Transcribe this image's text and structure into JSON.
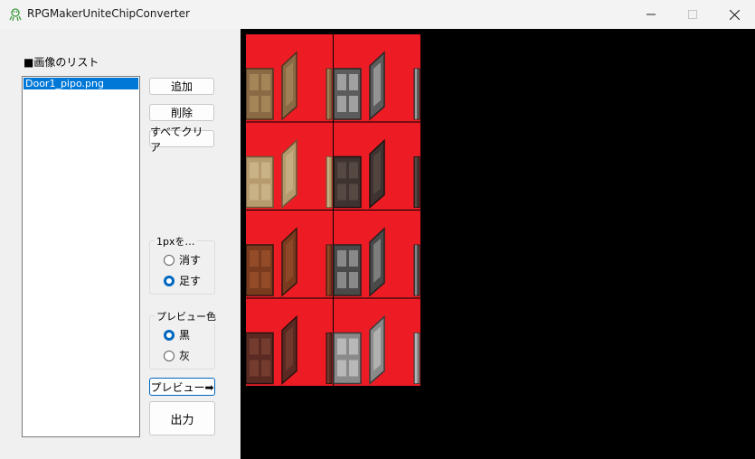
{
  "window": {
    "title": "RPGMakerUniteChipConverter",
    "icon": "frog-icon",
    "controls": {
      "minimize": "minimize-icon",
      "maximize": "maximize-icon",
      "close": "close-icon"
    }
  },
  "image_list": {
    "label": "■画像のリスト",
    "items": [
      {
        "name": "Door1_pipo.png",
        "selected": true
      }
    ]
  },
  "buttons": {
    "add": "追加",
    "remove": "削除",
    "clear_all": "すべてクリア",
    "preview": "プレビュー➡",
    "output": "出力"
  },
  "pixel_group": {
    "title": "1pxを…",
    "options": [
      {
        "label": "消す",
        "checked": false
      },
      {
        "label": "足す",
        "checked": true
      }
    ]
  },
  "preview_color_group": {
    "title": "プレビュー色",
    "options": [
      {
        "label": "黒",
        "checked": true
      },
      {
        "label": "灰",
        "checked": false
      }
    ]
  },
  "preview": {
    "background_color": "#000000",
    "tile_background_color": "#ed1c24",
    "tiles": [
      {
        "row": 0,
        "col": 0,
        "door": "wooden-plank-door"
      },
      {
        "row": 0,
        "col": 1,
        "door": "grey-paneled-door"
      },
      {
        "row": 1,
        "col": 0,
        "door": "light-wood-door"
      },
      {
        "row": 1,
        "col": 1,
        "door": "dark-wood-door"
      },
      {
        "row": 2,
        "col": 0,
        "door": "arched-wooden-door"
      },
      {
        "row": 2,
        "col": 1,
        "door": "iron-grate-door"
      },
      {
        "row": 3,
        "col": 0,
        "door": "brown-paneled-door"
      },
      {
        "row": 3,
        "col": 1,
        "door": "ornate-metal-door"
      }
    ]
  }
}
